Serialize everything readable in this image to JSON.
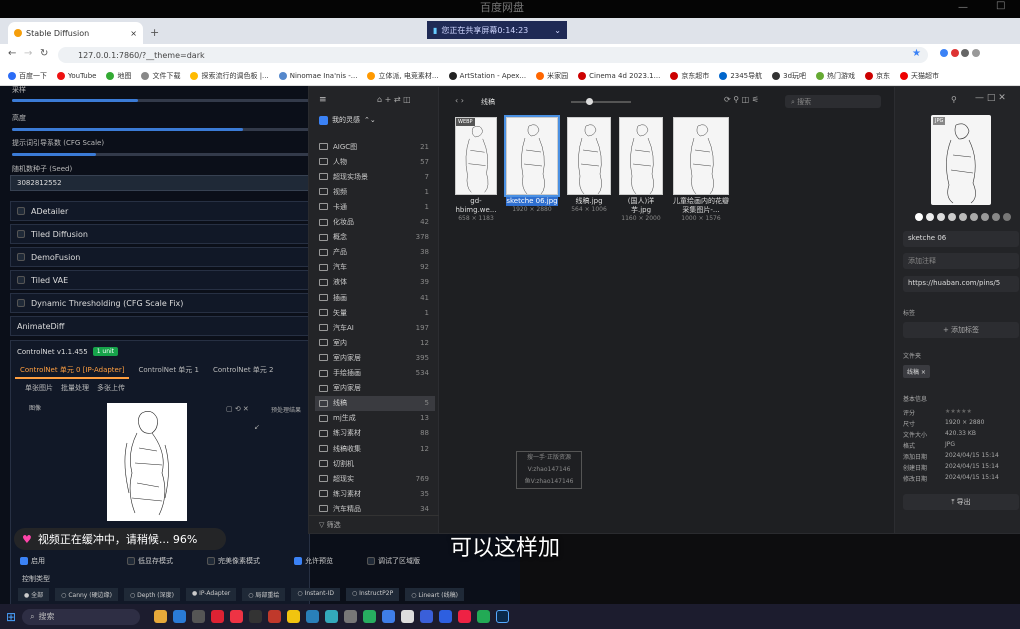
{
  "top": {
    "title": "百度网盘",
    "share_text": "您正在共享屏幕0:14:23"
  },
  "browser": {
    "tab_title": "Stable Diffusion",
    "url": "127.0.0.1:7860/?__theme=dark",
    "bookmarks": [
      "百度一下",
      "YouTube",
      "地图",
      "文件下载",
      "探索流行的调色板 |...",
      "Ninomae Ina'nis -...",
      "立体派, 电竞素材...",
      "ArtStation - Apex...",
      "米家园",
      "Cinema 4d 2023.1...",
      "京东超市",
      "2345导航",
      "3d玩吧",
      "热门游戏",
      "京东",
      "天猫超市"
    ]
  },
  "sd": {
    "slider_top": "采样",
    "denoise_label": "高度",
    "cfg_label": "提示词引导系数 (CFG Scale)",
    "seed_label": "随机数种子 (Seed)",
    "seed_value": "3082812552",
    "accordions": [
      "ADetailer",
      "Tiled Diffusion",
      "DemoFusion",
      "Tiled VAE",
      "Dynamic Thresholding (CFG Scale Fix)",
      "AnimateDiff"
    ],
    "cn_title": "ControlNet v1.1.455",
    "cn_badge": "1 unit",
    "cn_tabs": [
      "ControlNet 单元 0 [IP-Adapter]",
      "ControlNet 单元 1",
      "ControlNet 单元 2"
    ],
    "cn_subtabs": [
      "单张图片",
      "批量处理",
      "多张上传"
    ],
    "image_label": "图像",
    "preview_label": "预处理结果",
    "enable_label": "启用",
    "lowvram_label": "低显存模式",
    "perfect_label": "完美像素模式",
    "allow_preview_label": "允许预览",
    "upload_label": "调试了区域版",
    "control_type_label": "控制类型",
    "control_types": [
      "全部",
      "Canny (硬边缘)",
      "Depth (深度)",
      "IP-Adapter",
      "局部重绘",
      "Instant-ID",
      "InstructP2P",
      "Lineart (线稿)"
    ]
  },
  "eagle": {
    "library": "我的灵感",
    "folder_name": "线稿",
    "search_placeholder": "搜索",
    "folders": [
      {
        "name": "AIGC图",
        "count": "21"
      },
      {
        "name": "人物",
        "count": "57"
      },
      {
        "name": "超现实场景",
        "count": "7"
      },
      {
        "name": "视频",
        "count": "1"
      },
      {
        "name": "卡通",
        "count": "1"
      },
      {
        "name": "化妆品",
        "count": "42"
      },
      {
        "name": "概念",
        "count": "378"
      },
      {
        "name": "产品",
        "count": "38"
      },
      {
        "name": "汽车",
        "count": "92"
      },
      {
        "name": "液体",
        "count": "39"
      },
      {
        "name": "插画",
        "count": "41"
      },
      {
        "name": "矢量",
        "count": "1"
      },
      {
        "name": "汽车AI",
        "count": "197"
      },
      {
        "name": "室内",
        "count": "12"
      },
      {
        "name": "室内家居",
        "count": "395"
      },
      {
        "name": "手绘插画",
        "count": "534"
      },
      {
        "name": "室内家居",
        "count": ""
      },
      {
        "name": "线稿",
        "count": "5"
      },
      {
        "name": "mj生成",
        "count": "13"
      },
      {
        "name": "练习素材",
        "count": "88"
      },
      {
        "name": "线稿收集",
        "count": "12"
      },
      {
        "name": "切割机",
        "count": ""
      },
      {
        "name": "超现实",
        "count": "769"
      },
      {
        "name": "练习素材",
        "count": "35"
      },
      {
        "name": "汽车精品",
        "count": "34"
      }
    ],
    "filter_label": "筛选",
    "items": [
      {
        "name": "gd-hbimg.we...",
        "dims": "658 × 1183",
        "badge": "WEBP"
      },
      {
        "name": "sketche 06.jpg",
        "dims": "1920 × 2880",
        "badge": ""
      },
      {
        "name": "线稿.jpg",
        "dims": "564 × 1006",
        "badge": ""
      },
      {
        "name": "(国人)洋芋.jpg",
        "dims": "1160 × 2000",
        "badge": ""
      },
      {
        "name": "儿童绘画内的花瓣采集图片-...",
        "dims": "1000 × 1576",
        "badge": ""
      }
    ],
    "inspector": {
      "badge": "JPG",
      "name": "sketche 06",
      "note_placeholder": "添加注释",
      "url": "https://huaban.com/pins/5",
      "tags_label": "标签",
      "add_tag": "添加标签",
      "folder_label": "文件夹",
      "folder_chip": "线稿",
      "basic_label": "基本信息",
      "meta": [
        {
          "k": "评分",
          "v": ""
        },
        {
          "k": "尺寸",
          "v": "1920 × 2880"
        },
        {
          "k": "文件大小",
          "v": "420.33 KB"
        },
        {
          "k": "格式",
          "v": "JPG"
        },
        {
          "k": "添加日期",
          "v": "2024/04/15 15:14"
        },
        {
          "k": "创建日期",
          "v": "2024/04/15 15:14"
        },
        {
          "k": "修改日期",
          "v": "2024/04/15 15:14"
        }
      ],
      "export_label": "导出"
    }
  },
  "overlay": {
    "buffer": "视频正在缓冲中，请稍候... 96%",
    "subtitle": "可以这样加",
    "watermark": [
      "搜一手·正版资源",
      "V:zhao147146",
      "鱼V:zhao147146"
    ]
  },
  "taskbar": {
    "search": "搜索"
  }
}
